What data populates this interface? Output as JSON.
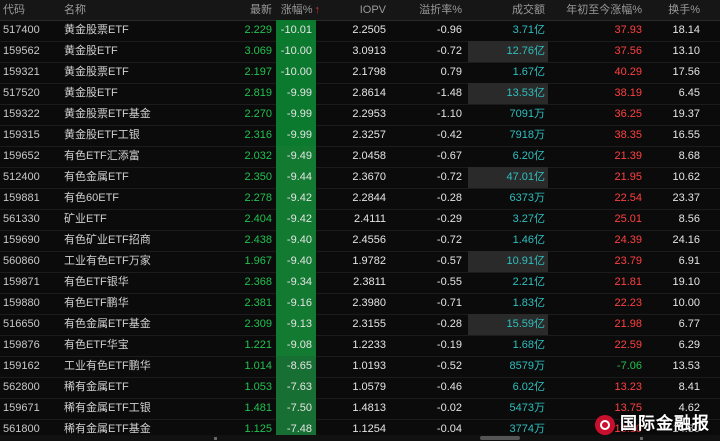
{
  "header": {
    "code": "代码",
    "name": "名称",
    "last": "最新",
    "change": "涨幅%",
    "sort_arrow": "↑",
    "iopv": "IOPV",
    "premium": "溢折率%",
    "volume": "成交额",
    "ytd": "年初至今涨幅%",
    "turnover": "换手%"
  },
  "rows": [
    {
      "code": "517400",
      "name": "黄金股票ETF",
      "last": "2.229",
      "change": "-10.01",
      "iopv": "2.2505",
      "premium": "-0.96",
      "volume": "3.71亿",
      "ytd": "37.93",
      "turnover": "18.14"
    },
    {
      "code": "159562",
      "name": "黄金股ETF",
      "last": "3.069",
      "change": "-10.00",
      "iopv": "3.0913",
      "premium": "-0.72",
      "volume": "12.76亿",
      "ytd": "37.56",
      "turnover": "13.10"
    },
    {
      "code": "159321",
      "name": "黄金股票ETF",
      "last": "2.197",
      "change": "-10.00",
      "iopv": "2.1798",
      "premium": "0.79",
      "volume": "1.67亿",
      "ytd": "40.29",
      "turnover": "17.56"
    },
    {
      "code": "517520",
      "name": "黄金股ETF",
      "last": "2.819",
      "change": "-9.99",
      "iopv": "2.8614",
      "premium": "-1.48",
      "volume": "13.53亿",
      "ytd": "38.19",
      "turnover": "6.45"
    },
    {
      "code": "159322",
      "name": "黄金股票ETF基金",
      "last": "2.270",
      "change": "-9.99",
      "iopv": "2.2953",
      "premium": "-1.10",
      "volume": "7091万",
      "ytd": "36.25",
      "turnover": "19.37"
    },
    {
      "code": "159315",
      "name": "黄金股ETF工银",
      "last": "2.316",
      "change": "-9.99",
      "iopv": "2.3257",
      "premium": "-0.42",
      "volume": "7918万",
      "ytd": "38.35",
      "turnover": "16.55"
    },
    {
      "code": "159652",
      "name": "有色ETF汇添富",
      "last": "2.032",
      "change": "-9.49",
      "iopv": "2.0458",
      "premium": "-0.67",
      "volume": "6.20亿",
      "ytd": "21.39",
      "turnover": "8.68"
    },
    {
      "code": "512400",
      "name": "有色金属ETF",
      "last": "2.350",
      "change": "-9.44",
      "iopv": "2.3670",
      "premium": "-0.72",
      "volume": "47.01亿",
      "ytd": "21.95",
      "turnover": "10.62"
    },
    {
      "code": "159881",
      "name": "有色60ETF",
      "last": "2.278",
      "change": "-9.42",
      "iopv": "2.2844",
      "premium": "-0.28",
      "volume": "6373万",
      "ytd": "22.54",
      "turnover": "23.37"
    },
    {
      "code": "561330",
      "name": "矿业ETF",
      "last": "2.404",
      "change": "-9.42",
      "iopv": "2.4111",
      "premium": "-0.29",
      "volume": "3.27亿",
      "ytd": "25.01",
      "turnover": "8.56"
    },
    {
      "code": "159690",
      "name": "有色矿业ETF招商",
      "last": "2.438",
      "change": "-9.40",
      "iopv": "2.4556",
      "premium": "-0.72",
      "volume": "1.46亿",
      "ytd": "24.39",
      "turnover": "24.16"
    },
    {
      "code": "560860",
      "name": "工业有色ETF万家",
      "last": "1.967",
      "change": "-9.40",
      "iopv": "1.9782",
      "premium": "-0.57",
      "volume": "10.91亿",
      "ytd": "23.79",
      "turnover": "6.91"
    },
    {
      "code": "159871",
      "name": "有色ETF银华",
      "last": "2.368",
      "change": "-9.34",
      "iopv": "2.3811",
      "premium": "-0.55",
      "volume": "2.21亿",
      "ytd": "21.81",
      "turnover": "19.10"
    },
    {
      "code": "159880",
      "name": "有色ETF鹏华",
      "last": "2.381",
      "change": "-9.16",
      "iopv": "2.3980",
      "premium": "-0.71",
      "volume": "1.83亿",
      "ytd": "22.23",
      "turnover": "10.00"
    },
    {
      "code": "516650",
      "name": "有色金属ETF基金",
      "last": "2.309",
      "change": "-9.13",
      "iopv": "2.3155",
      "premium": "-0.28",
      "volume": "15.59亿",
      "ytd": "21.98",
      "turnover": "6.77"
    },
    {
      "code": "159876",
      "name": "有色ETF华宝",
      "last": "1.221",
      "change": "-9.08",
      "iopv": "1.2233",
      "premium": "-0.19",
      "volume": "1.68亿",
      "ytd": "22.59",
      "turnover": "6.29"
    },
    {
      "code": "159162",
      "name": "工业有色ETF鹏华",
      "last": "1.014",
      "change": "-8.65",
      "iopv": "1.0193",
      "premium": "-0.52",
      "volume": "8579万",
      "ytd": "-7.06",
      "turnover": "13.53"
    },
    {
      "code": "562800",
      "name": "稀有金属ETF",
      "last": "1.053",
      "change": "-7.63",
      "iopv": "1.0579",
      "premium": "-0.46",
      "volume": "6.02亿",
      "ytd": "13.23",
      "turnover": "8.41"
    },
    {
      "code": "159671",
      "name": "稀有金属ETF工银",
      "last": "1.481",
      "change": "-7.50",
      "iopv": "1.4813",
      "premium": "-0.02",
      "volume": "5473万",
      "ytd": "13.75",
      "turnover": "4.62"
    },
    {
      "code": "561800",
      "name": "稀有金属ETF基金",
      "last": "1.125",
      "change": "-7.48",
      "iopv": "1.1254",
      "premium": "-0.04",
      "volume": "3774万",
      "ytd": "13.10",
      "turnover": "14.80"
    }
  ],
  "watermark": "国际金融报",
  "colors": {
    "up": "#ff4040",
    "down": "#21c24f",
    "change_bg_strong": "#0b7a2e",
    "change_bg_mid": "#186f33"
  }
}
